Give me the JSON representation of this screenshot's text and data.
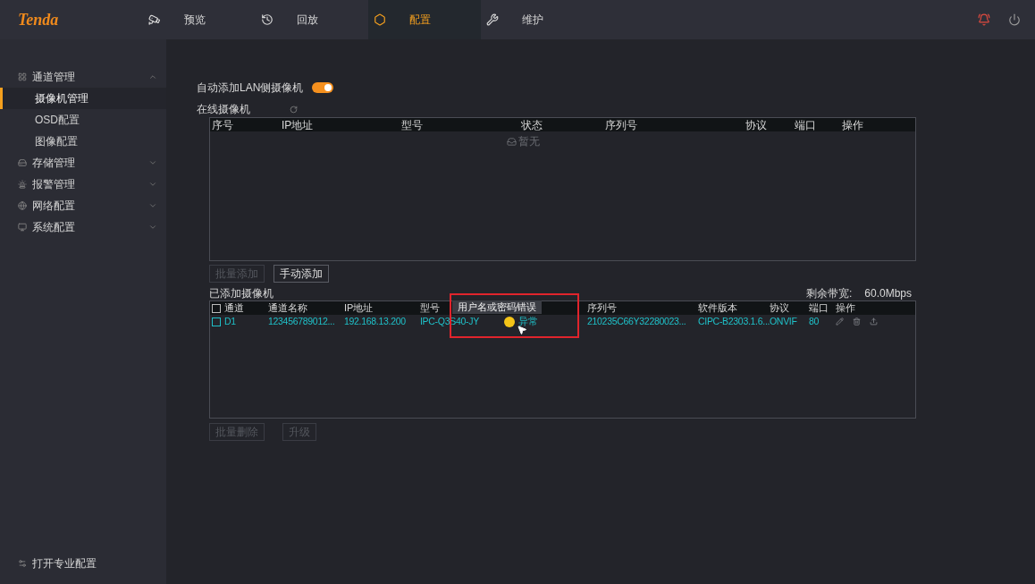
{
  "logo": "Tenda",
  "nav": [
    {
      "label": "预览",
      "selected": false
    },
    {
      "label": "回放",
      "selected": false
    },
    {
      "label": "配置",
      "selected": true
    },
    {
      "label": "维护",
      "selected": false
    }
  ],
  "sidebar": {
    "items": [
      {
        "label": "通道管理",
        "expanded": true,
        "children": [
          {
            "label": "摄像机管理",
            "selected": true
          },
          {
            "label": "OSD配置",
            "selected": false
          },
          {
            "label": "图像配置",
            "selected": false
          }
        ]
      },
      {
        "label": "存储管理",
        "expanded": false
      },
      {
        "label": "报警管理",
        "expanded": false
      },
      {
        "label": "网络配置",
        "expanded": false
      },
      {
        "label": "系统配置",
        "expanded": false
      }
    ],
    "footer": "打开专业配置"
  },
  "auto_add": {
    "label": "自动添加LAN侧摄像机",
    "on": true
  },
  "online": {
    "title": "在线摄像机",
    "columns": [
      "序号",
      "IP地址",
      "型号",
      "状态",
      "序列号",
      "协议",
      "端口",
      "操作"
    ],
    "empty": "暂无"
  },
  "buttons": [
    {
      "label": "批量添加",
      "disabled": true
    },
    {
      "label": "手动添加",
      "disabled": false
    }
  ],
  "added": {
    "title": "已添加摄像机",
    "bandwidth_label": "剩余带宽:",
    "bandwidth": "60.0Mbps",
    "tooltip": "用户名或密码错误",
    "all_checked": false,
    "columns": [
      "通道",
      "通道名称",
      "IP地址",
      "型号",
      "序列号",
      "软件版本",
      "协议",
      "端口",
      "操作"
    ],
    "rows": [
      {
        "checked": false,
        "channel": "D1",
        "name": "123456789012...",
        "ip": "192.168.13.200",
        "model": "IPC-Q3S40-JY",
        "status": "异常",
        "color": "#f5c518",
        "serial": "210235C66Y32280023...",
        "firmware": "CIPC-B2303.1.6...",
        "protocol": "ONVIF",
        "port": "80"
      }
    ]
  },
  "bottom_buttons": [
    {
      "label": "批量删除",
      "disabled": true
    },
    {
      "label": "升级",
      "disabled": true
    }
  ],
  "highlight": true
}
